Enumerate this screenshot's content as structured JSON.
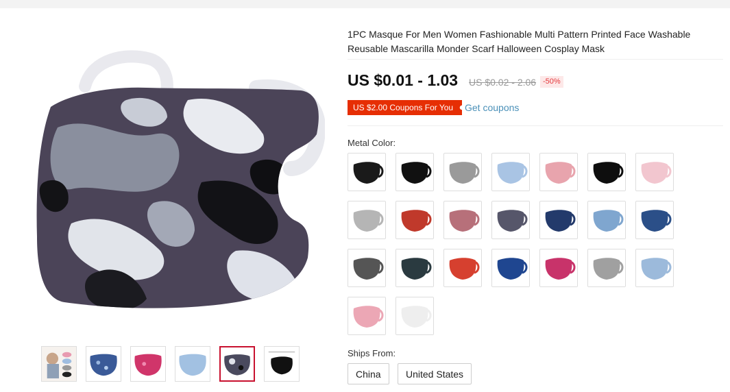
{
  "product": {
    "title": "1PC Masque For Men Women Fashionable Multi Pattern Printed Face Washable Reusable Mascarilla Monder Scarf Halloween Cosplay Mask",
    "price": "US $0.01 - 1.03",
    "original_price": "US $0.02 - 2.06",
    "discount": "-50%"
  },
  "coupon": {
    "tag": "US $2.00 Coupons For You",
    "link": "Get coupons"
  },
  "color_section": {
    "label": "Metal Color:",
    "swatches": [
      {
        "name": "black-1",
        "color": "#1a1a1a"
      },
      {
        "name": "black-2",
        "color": "#111111"
      },
      {
        "name": "gray",
        "color": "#9a9a9a"
      },
      {
        "name": "light-blue",
        "color": "#a9c4e4"
      },
      {
        "name": "pink",
        "color": "#e8a4ad"
      },
      {
        "name": "black-3",
        "color": "#0e0e0e"
      },
      {
        "name": "light-pink",
        "color": "#f2c6cf"
      },
      {
        "name": "gray-2",
        "color": "#b5b5b5"
      },
      {
        "name": "camo-red",
        "color": "#c0392b"
      },
      {
        "name": "camo-pink",
        "color": "#b7707a"
      },
      {
        "name": "camo-gray",
        "color": "#56566a"
      },
      {
        "name": "camo-navy",
        "color": "#233a6b"
      },
      {
        "name": "sequin-light-blue",
        "color": "#7fa6cf"
      },
      {
        "name": "sequin-blue",
        "color": "#2b4f88"
      },
      {
        "name": "camo-white",
        "color": "#555555"
      },
      {
        "name": "sequin-dark",
        "color": "#2a3a40"
      },
      {
        "name": "sequin-red",
        "color": "#d6402f"
      },
      {
        "name": "sequin-royal-blue",
        "color": "#1f4690"
      },
      {
        "name": "sequin-magenta",
        "color": "#c8336a"
      },
      {
        "name": "gray-3",
        "color": "#a0a0a0"
      },
      {
        "name": "sky-blue",
        "color": "#9cbadb"
      },
      {
        "name": "pink-2",
        "color": "#eca7b5"
      },
      {
        "name": "white",
        "color": "#eeeeee"
      }
    ]
  },
  "ships_from": {
    "label": "Ships From:",
    "options": [
      "China",
      "United States"
    ]
  },
  "thumbnails": [
    {
      "name": "model",
      "color": "#c8b8a8"
    },
    {
      "name": "sequin-blue",
      "color": "#3a5a98"
    },
    {
      "name": "sequin-pink",
      "color": "#d0356a"
    },
    {
      "name": "light-blue",
      "color": "#a2c1e2"
    },
    {
      "name": "camo",
      "color": "#4a4a5e",
      "active": true
    },
    {
      "name": "black-size",
      "color": "#111111"
    }
  ]
}
